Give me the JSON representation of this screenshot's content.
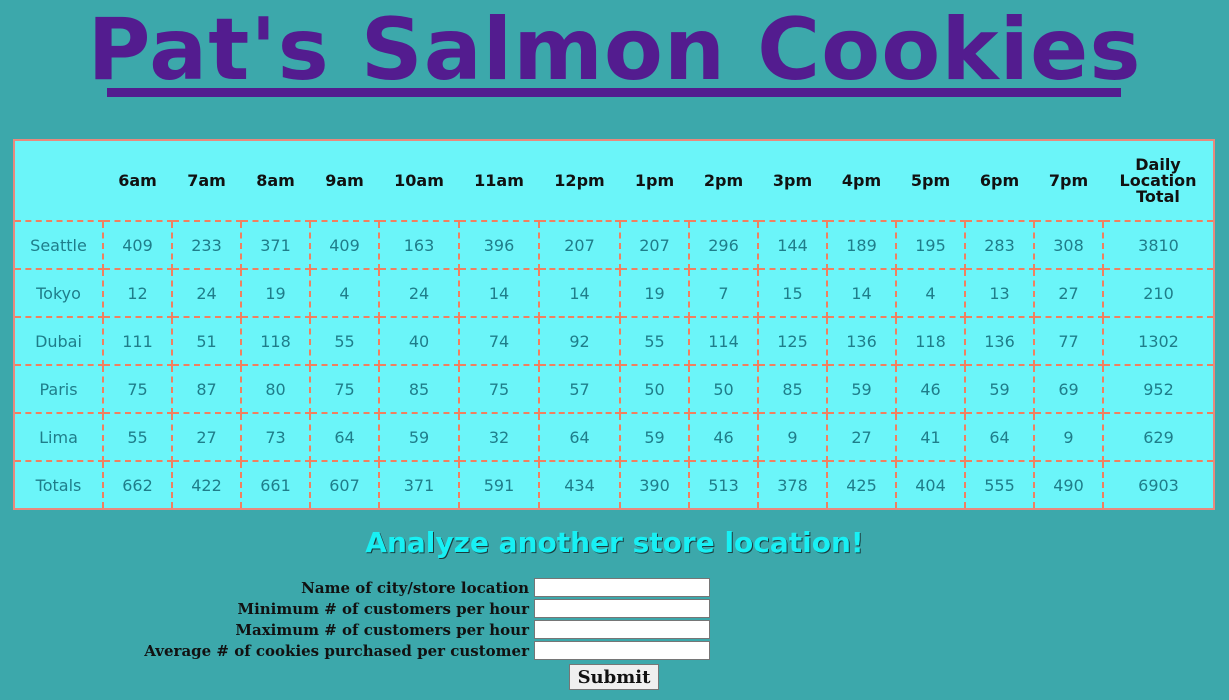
{
  "page": {
    "title": "Pat's Salmon Cookies"
  },
  "table": {
    "headers": [
      "",
      "6am",
      "7am",
      "8am",
      "9am",
      "10am",
      "11am",
      "12pm",
      "1pm",
      "2pm",
      "3pm",
      "4pm",
      "5pm",
      "6pm",
      "7pm"
    ],
    "total_header_lines": [
      "Daily",
      "Location",
      "Total"
    ],
    "rows": [
      {
        "name": "Seattle",
        "values": [
          "409",
          "233",
          "371",
          "409",
          "163",
          "396",
          "207",
          "207",
          "296",
          "144",
          "189",
          "195",
          "283",
          "308"
        ],
        "total": "3810"
      },
      {
        "name": "Tokyo",
        "values": [
          "12",
          "24",
          "19",
          "4",
          "24",
          "14",
          "14",
          "19",
          "7",
          "15",
          "14",
          "4",
          "13",
          "27"
        ],
        "total": "210"
      },
      {
        "name": "Dubai",
        "values": [
          "111",
          "51",
          "118",
          "55",
          "40",
          "74",
          "92",
          "55",
          "114",
          "125",
          "136",
          "118",
          "136",
          "77"
        ],
        "total": "1302"
      },
      {
        "name": "Paris",
        "values": [
          "75",
          "87",
          "80",
          "75",
          "85",
          "75",
          "57",
          "50",
          "50",
          "85",
          "59",
          "46",
          "59",
          "69"
        ],
        "total": "952"
      },
      {
        "name": "Lima",
        "values": [
          "55",
          "27",
          "73",
          "64",
          "59",
          "32",
          "64",
          "59",
          "46",
          "9",
          "27",
          "41",
          "64",
          "9"
        ],
        "total": "629"
      }
    ],
    "totals_row": {
      "name": "Totals",
      "values": [
        "662",
        "422",
        "661",
        "607",
        "371",
        "591",
        "434",
        "390",
        "513",
        "378",
        "425",
        "404",
        "555",
        "490"
      ],
      "total": "6903"
    }
  },
  "form": {
    "heading": "Analyze another store location!",
    "fields": [
      {
        "label": "Name of city/store location",
        "value": ""
      },
      {
        "label": "Minimum # of customers per hour",
        "value": ""
      },
      {
        "label": "Maximum # of customers per hour",
        "value": ""
      },
      {
        "label": "Average # of cookies purchased per customer",
        "value": ""
      }
    ],
    "submit_label": "Submit"
  }
}
